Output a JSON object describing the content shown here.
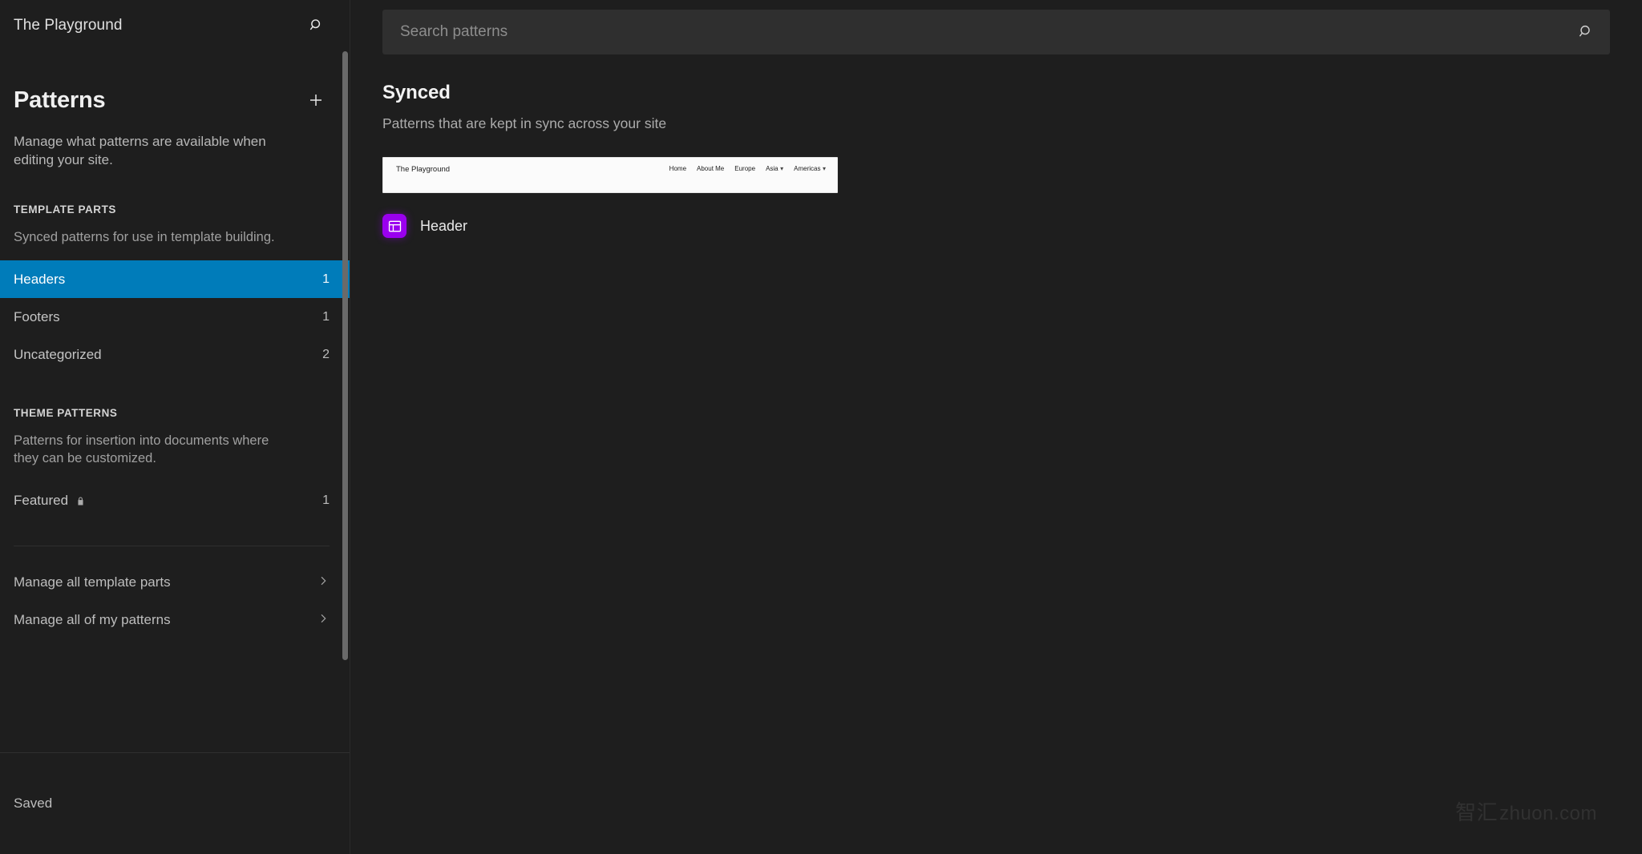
{
  "sidebar": {
    "site_title": "The Playground",
    "search_icon": "search-icon",
    "panel": {
      "title": "Patterns",
      "add_icon": "plus-icon",
      "description": "Manage what patterns are available when editing your site."
    },
    "groups": [
      {
        "label": "TEMPLATE PARTS",
        "description": "Synced patterns for use in template building.",
        "items": [
          {
            "label": "Headers",
            "count": "1",
            "selected": true,
            "locked": false
          },
          {
            "label": "Footers",
            "count": "1",
            "selected": false,
            "locked": false
          },
          {
            "label": "Uncategorized",
            "count": "2",
            "selected": false,
            "locked": false
          }
        ]
      },
      {
        "label": "THEME PATTERNS",
        "description": "Patterns for insertion into documents where they can be customized.",
        "items": [
          {
            "label": "Featured",
            "count": "1",
            "selected": false,
            "locked": true,
            "lock_icon": "lock-icon"
          }
        ]
      }
    ],
    "manage_links": [
      {
        "label": "Manage all template parts",
        "chevron": "chevron-right-icon"
      },
      {
        "label": "Manage all of my patterns",
        "chevron": "chevron-right-icon"
      }
    ],
    "footer": {
      "label": "Saved"
    }
  },
  "main": {
    "search": {
      "placeholder": "Search patterns",
      "value": "",
      "icon": "search-icon"
    },
    "section": {
      "title": "Synced",
      "subtitle": "Patterns that are kept in sync across your site"
    },
    "patterns": [
      {
        "name": "Header",
        "icon": "template-part-icon",
        "icon_color": "#9a00ef",
        "preview": {
          "brand": "The Playground",
          "nav": [
            {
              "label": "Home",
              "has_submenu": false
            },
            {
              "label": "About Me",
              "has_submenu": false
            },
            {
              "label": "Europe",
              "has_submenu": false
            },
            {
              "label": "Asia",
              "has_submenu": true
            },
            {
              "label": "Americas",
              "has_submenu": true
            }
          ],
          "submenu_icon": "chevron-down-icon"
        }
      }
    ]
  },
  "watermark": {
    "cn": "智汇",
    "en": "zhuon.com"
  },
  "colors": {
    "accent": "#007cba",
    "icon_purple": "#9a00ef",
    "background": "#1e1e1e"
  }
}
